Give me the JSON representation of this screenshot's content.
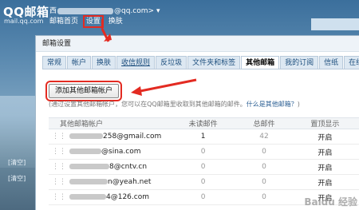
{
  "app": {
    "logo": "QQ邮箱",
    "logo_sub": "mail.qq.com",
    "user_prefix": "西",
    "user_suffix": "@qq.com>"
  },
  "nav": [
    "邮箱首页",
    "设置",
    "换肤"
  ],
  "panel": {
    "title": "邮箱设置",
    "tabs": [
      "常规",
      "帐户",
      "换肤",
      "收信规则",
      "反垃圾",
      "文件夹和标签",
      "其他邮箱",
      "我的订阅",
      "信纸",
      "在线"
    ],
    "active_tab": "其他邮箱"
  },
  "add_button": "添加其他邮箱帐户",
  "hint": {
    "prefix": "(通过设置其他邮箱帐户，您可以在QQ邮箱里收取到其他邮箱的邮件。",
    "link": "什么是其他邮箱？",
    "suffix": ")"
  },
  "table": {
    "headers": [
      "其他邮箱帐户",
      "未读邮件",
      "总邮件",
      "置顶显示"
    ],
    "rows": [
      {
        "account": "258@gmail.com",
        "unread": "1",
        "total": "42",
        "pin": "开启"
      },
      {
        "account": "@sina.com",
        "unread": "0",
        "total": "0",
        "pin": "开启"
      },
      {
        "account": "8@cntv.cn",
        "unread": "0",
        "total": "0",
        "pin": "开启"
      },
      {
        "account": "n@yeah.net",
        "unread": "0",
        "total": "0",
        "pin": "开启"
      },
      {
        "account": "4@126.com",
        "unread": "0",
        "total": "0",
        "pin": "开启"
      }
    ]
  },
  "sidebar": {
    "clear_label": "[清空]"
  },
  "watermark": "Baidu 经验",
  "colors": {
    "highlight": "#e32b22",
    "tab_text": "#1e4f7e",
    "link": "#2b5f93"
  }
}
